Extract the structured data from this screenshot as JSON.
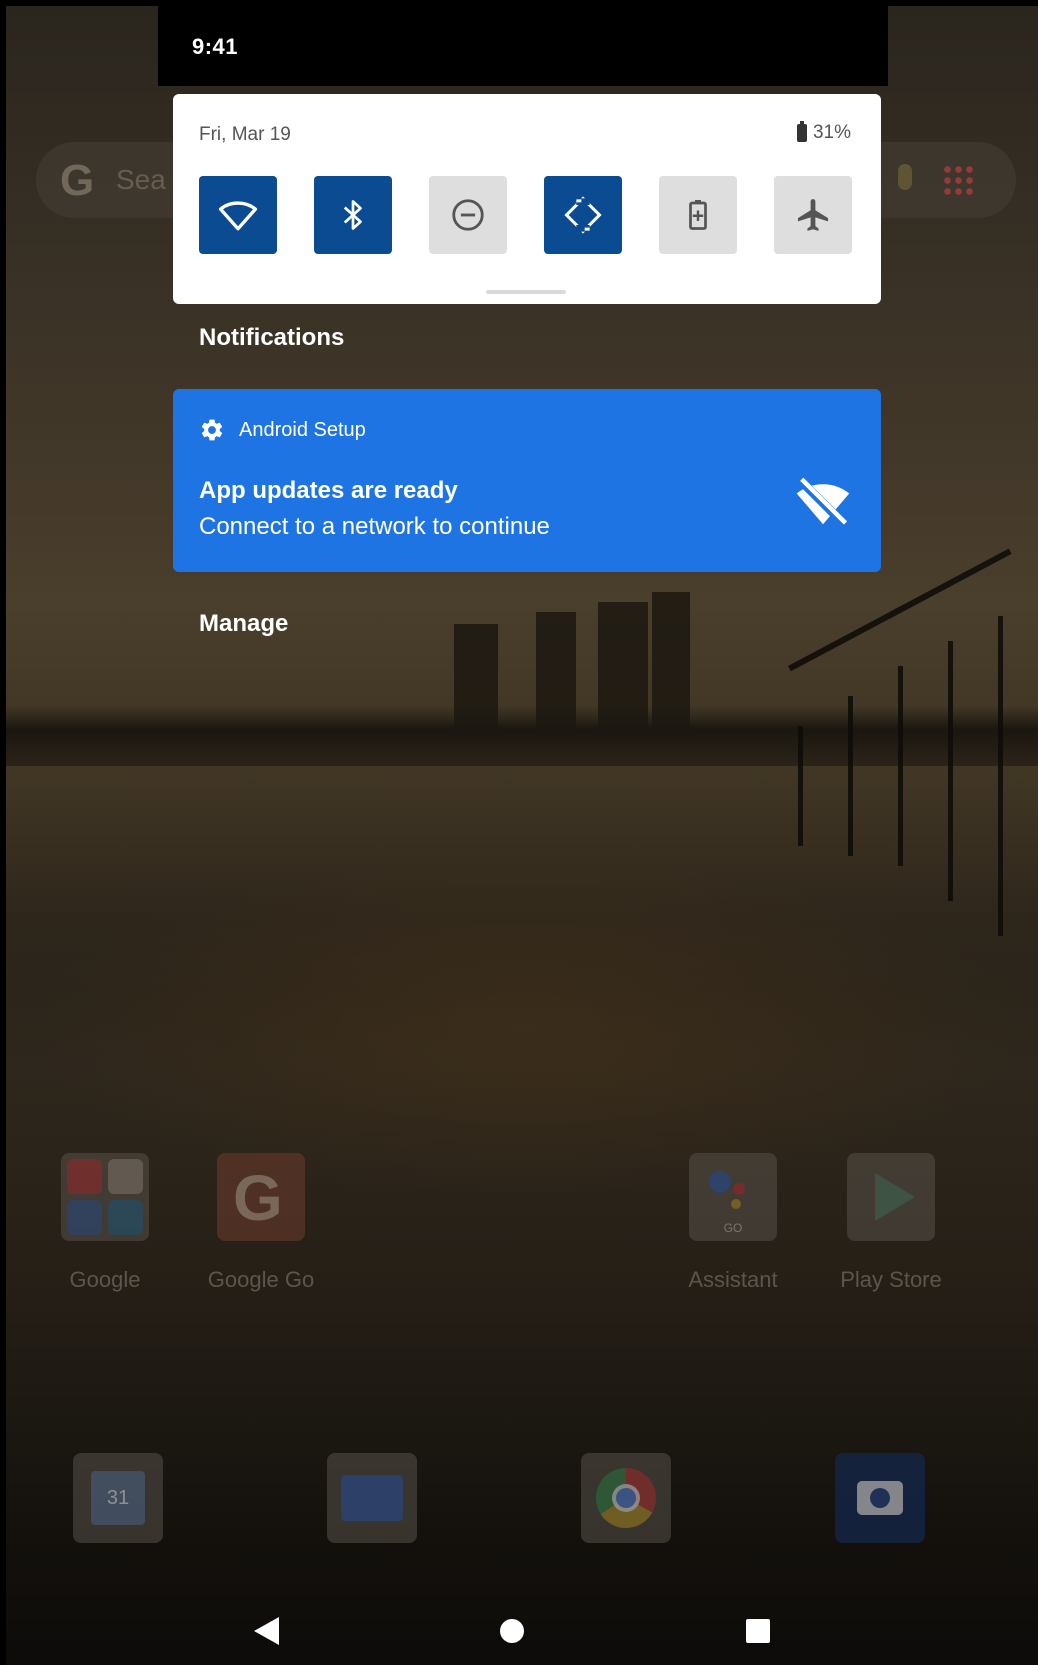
{
  "status_bar": {
    "time": "9:41"
  },
  "quick_settings": {
    "date": "Fri, Mar 19",
    "battery_percent": "31%",
    "tiles": [
      {
        "name": "wifi",
        "icon": "wifi-icon",
        "on": true
      },
      {
        "name": "bluetooth",
        "icon": "bluetooth-icon",
        "on": true
      },
      {
        "name": "do-not-disturb",
        "icon": "do-not-disturb-icon",
        "on": false
      },
      {
        "name": "auto-rotate",
        "icon": "auto-rotate-icon",
        "on": true
      },
      {
        "name": "battery-saver",
        "icon": "battery-saver-icon",
        "on": false
      },
      {
        "name": "airplane-mode",
        "icon": "airplane-icon",
        "on": false
      }
    ]
  },
  "notifications": {
    "header": "Notifications",
    "items": [
      {
        "app_name": "Android Setup",
        "app_icon": "gear-icon",
        "title": "App updates are ready",
        "text": "Connect to a network to continue",
        "large_icon": "wifi-off-icon"
      }
    ],
    "manage_label": "Manage"
  },
  "home_screen": {
    "search_partial": "Sea",
    "apps": [
      {
        "label": "Google"
      },
      {
        "label": "Google Go"
      },
      {
        "label": "Assistant"
      },
      {
        "label": "Play Store"
      }
    ],
    "dock": [
      {
        "icon": "calendar-icon",
        "text": "31"
      },
      {
        "icon": "files-icon"
      },
      {
        "icon": "chrome-icon"
      },
      {
        "icon": "camera-icon"
      }
    ],
    "assistant_badge": "GO"
  },
  "nav_bar": {
    "buttons": [
      "back",
      "home",
      "recents"
    ]
  },
  "colors": {
    "tile_on": "#0a4b91",
    "tile_off": "#dedede",
    "notification_bg": "#1e74e3"
  }
}
